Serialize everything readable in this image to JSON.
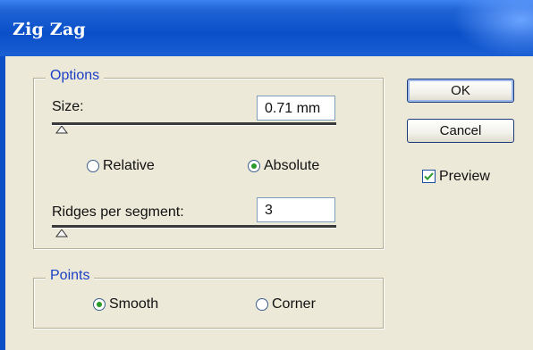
{
  "window": {
    "title": "Zig Zag"
  },
  "options": {
    "legend": "Options",
    "size_label": "Size:",
    "size_value": "0.71 mm",
    "size_slider_level": 0.02,
    "relative_label": "Relative",
    "absolute_label": "Absolute",
    "selected_mode": "Absolute",
    "ridges_label": "Ridges per segment:",
    "ridges_value": "3",
    "ridges_slider_level": 0.02
  },
  "points": {
    "legend": "Points",
    "smooth_label": "Smooth",
    "corner_label": "Corner",
    "selected": "Smooth"
  },
  "buttons": {
    "ok": "OK",
    "cancel": "Cancel"
  },
  "preview": {
    "label": "Preview",
    "checked": true
  },
  "colors": {
    "titlebar": "#0a4fc8",
    "legend_text": "#1c3fc7",
    "radio_selected": "#2a9a2a",
    "dialog_bg": "#ece9d8"
  }
}
